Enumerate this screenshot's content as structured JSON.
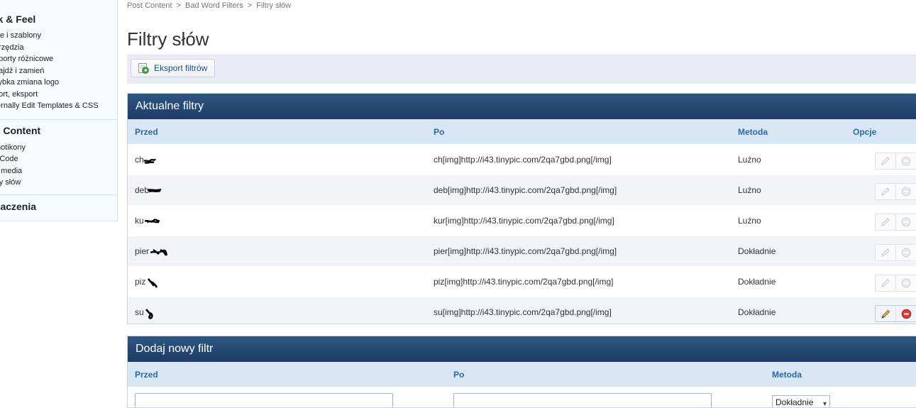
{
  "sidebar": {
    "sections": [
      {
        "title": "ok & Feel",
        "items": [
          "yle i szablony",
          "arzędzia",
          "aporty różnicowe",
          "najdź i zamień",
          "zybka zmiana logo",
          "port, eksport",
          "ternally Edit Templates & CSS"
        ]
      },
      {
        "title": "st Content",
        "items": [
          "motikony",
          "BCode",
          "g media",
          "try słów"
        ]
      },
      {
        "title": "maczenia",
        "items": []
      }
    ]
  },
  "breadcrumb": [
    "Post Content",
    "Bad Word Filters",
    "Filtry słów"
  ],
  "page_title": "Filtry słów",
  "toolbar": {
    "export_label": "Eksport filtrów"
  },
  "current_filters": {
    "title": "Aktualne filtry",
    "columns": [
      "Przed",
      "Po",
      "Metoda",
      "Opcje"
    ],
    "rows": [
      {
        "before": "ch",
        "after": "ch[img]http://i43.tinypic.com/2qa7gbd.png[/img]",
        "method": "Luźno"
      },
      {
        "before": "deb",
        "after": "deb[img]http://i43.tinypic.com/2qa7gbd.png[/img]",
        "method": "Luźno"
      },
      {
        "before": "ku",
        "after": "kur[img]http://i43.tinypic.com/2qa7gbd.png[/img]",
        "method": "Luźno"
      },
      {
        "before": "pier",
        "after": "pier[img]http://i43.tinypic.com/2qa7gbd.png[/img]",
        "method": "Dokładnie"
      },
      {
        "before": "piz",
        "after": "piz[img]http://i43.tinypic.com/2qa7gbd.png[/img]",
        "method": "Dokładnie"
      },
      {
        "before": "su",
        "after": "su[img]http://i43.tinypic.com/2qa7gbd.png[/img]",
        "method": "Dokładnie"
      }
    ]
  },
  "new_filter": {
    "title": "Dodaj nowy filtr",
    "columns": [
      "Przed",
      "Po",
      "Metoda"
    ],
    "before_value": "",
    "after_value": "",
    "method_selected": "Dokładnie"
  },
  "icons": {
    "export": "export-icon",
    "edit": "pencil-icon",
    "delete": "minus-circle-icon"
  },
  "colors": {
    "panel_header": "#1c3c64",
    "column_header_bg": "#d9e6f4",
    "column_header_text": "#2a6aa5",
    "delete_active": "#e0393b"
  }
}
